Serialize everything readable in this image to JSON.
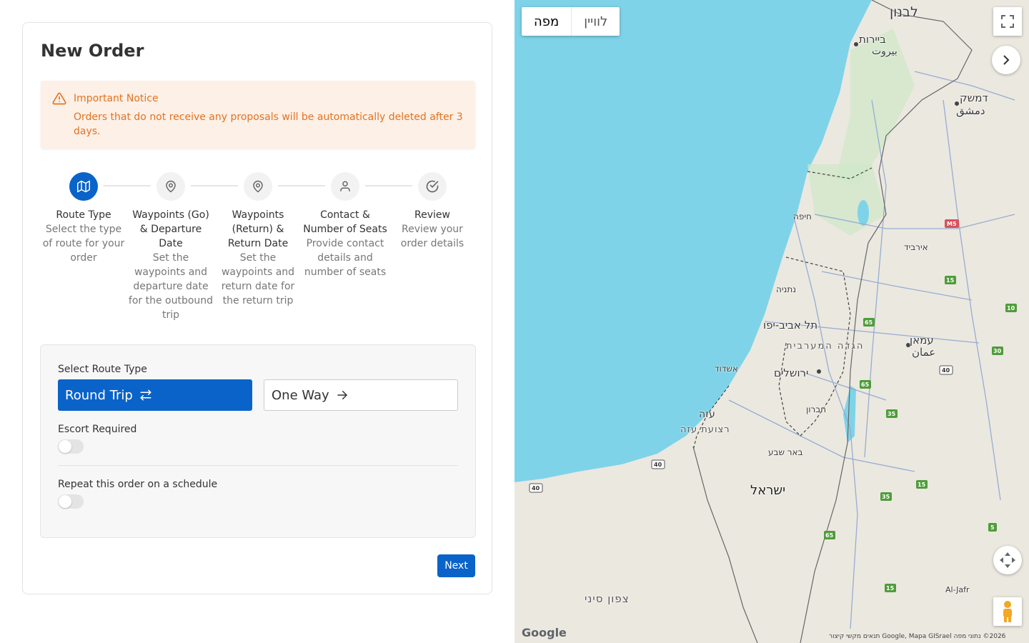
{
  "page": {
    "title": "New Order"
  },
  "notice": {
    "title": "Important Notice",
    "body": "Orders that do not receive any proposals will be automatically deleted after 3 days."
  },
  "steps": [
    {
      "label": "Route Type",
      "desc": "Select the type of route for your order",
      "icon": "map-icon",
      "active": true
    },
    {
      "label": "Waypoints (Go) & Departure Date",
      "desc": "Set the waypoints and departure date for the outbound trip",
      "icon": "map-pin-icon",
      "active": false
    },
    {
      "label": "Waypoints (Return) & Return Date",
      "desc": "Set the waypoints and return date for the return trip",
      "icon": "map-pin-icon",
      "active": false
    },
    {
      "label": "Contact & Number of Seats",
      "desc": "Provide contact details and number of seats",
      "icon": "user-icon",
      "active": false
    },
    {
      "label": "Review",
      "desc": "Review your order details",
      "icon": "check-circle-icon",
      "active": false
    }
  ],
  "route": {
    "label": "Select Route Type",
    "round_trip": "Round Trip",
    "one_way": "One Way",
    "selected": "Round Trip"
  },
  "escort": {
    "label": "Escort Required",
    "on": false
  },
  "repeat": {
    "label": "Repeat this order on a schedule",
    "on": false
  },
  "actions": {
    "next": "Next"
  },
  "map": {
    "type_map": "מפה",
    "type_satellite": "לוויין",
    "labels": {
      "lebanon": "לבנון",
      "beirut_he": "ביירות",
      "beirut_ar": "بيروت",
      "damascus_he": "דמשק",
      "damascus_ar": "دمشق",
      "haifa": "חיפה",
      "tel_aviv": "תל אביב-יפו",
      "jerusalem": "ירושלים",
      "amman_he": "עמאן",
      "amman_ar": "عمان",
      "west_bank": "הגדה המערבית",
      "gaza": "עזה",
      "gaza_strip": "רצועת עזה",
      "israel": "ישראל",
      "beersheba": "באר שבע",
      "ashdod": "אשדוד",
      "hebron": "חברון",
      "sinai": "צפון סיני",
      "aqaba": "Al-Jafr",
      "irbid": "אירביד",
      "netanya": "נתניה"
    },
    "footer": "2026© נתוני מפה Google, Mapa GISrael   תנאים   מקשי קיצור",
    "logo": "Google"
  },
  "colors": {
    "primary": "#0a63c9",
    "notice_bg": "#fdf0e6",
    "notice_text": "#e27323",
    "sea": "#7fd3e8",
    "land": "#ebe8e0"
  }
}
